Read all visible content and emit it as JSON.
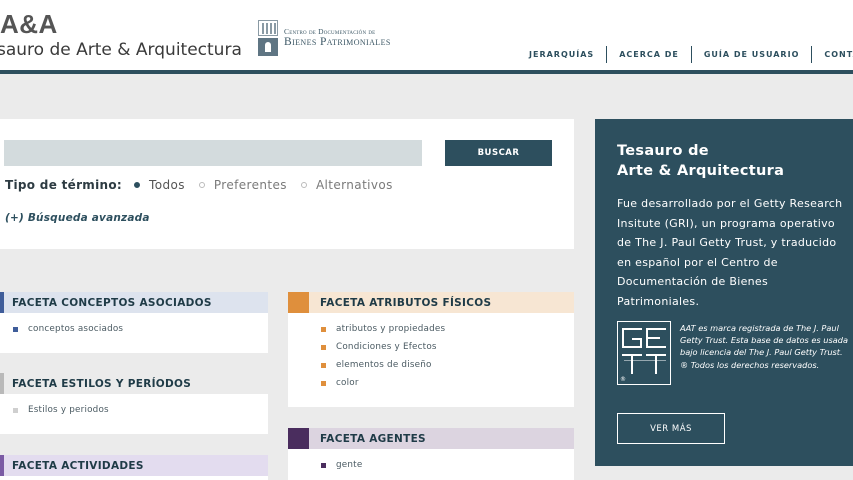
{
  "header": {
    "logo_title": "A&A",
    "logo_subtitle": "sauro de Arte & Arquitectura",
    "partner_line1": "Centro de Documentación de",
    "partner_line2": "Bienes Patrimoniales",
    "nav": [
      "JERARQUÍAS",
      "ACERCA DE",
      "GUÍA DE USUARIO",
      "CONTACTO"
    ]
  },
  "search": {
    "input_value": "",
    "input_placeholder": "",
    "button_label": "BUSCAR",
    "term_type_label": "Tipo de término:",
    "options": [
      {
        "label": "Todos",
        "selected": true
      },
      {
        "label": "Preferentes",
        "selected": false
      },
      {
        "label": "Alternativos",
        "selected": false
      }
    ],
    "advanced_label": "(+) Búsqueda avanzada"
  },
  "facets": {
    "conceptos": {
      "title": "FACETA CONCEPTOS ASOCIADOS",
      "accent": "#3f5d9a",
      "head_bg": "#dde3ee",
      "items": [
        "conceptos asociados"
      ]
    },
    "estilos": {
      "title": "FACETA ESTILOS Y PERÍODOS",
      "accent": "#b9b9b9",
      "head_bg": "#ebebeb",
      "items": [
        "Estilos y periodos"
      ]
    },
    "actividades": {
      "title": "FACETA ACTIVIDADES",
      "accent": "#7b5ba4",
      "head_bg": "#e3dcef",
      "items": []
    },
    "atributos": {
      "title": "FACETA ATRIBUTOS FÍSICOS",
      "accent": "#df8f3c",
      "head_bg": "#f7e6d3",
      "items": [
        "atributos y propiedades",
        "Condiciones y Efectos",
        "elementos de diseño",
        "color"
      ]
    },
    "agentes": {
      "title": "FACETA AGENTES",
      "accent": "#4a2d5e",
      "head_bg": "#dcd4e0",
      "items": [
        "gente"
      ]
    }
  },
  "info": {
    "title_line1": "Tesauro de",
    "title_line2": "Arte & Arquitectura",
    "description": "Fue desarrollado por el Getty Research Insitute (GRI), un programa operativo de The J. Paul Getty Trust, y traducido en español por el Centro de Documentación de Bienes Patrimoniales.",
    "getty_note_line1": "AAT es marca registrada de The J. Paul Getty Trust. Esta base de datos es usada bajo licencia del The J. Paul Getty Trust.",
    "getty_note_line2": "® Todos los derechos reservados.",
    "getty_reg": "®",
    "button_label": "VER MÁS"
  },
  "colors": {
    "brand": "#2d4f5e",
    "background": "#ebebeb"
  }
}
